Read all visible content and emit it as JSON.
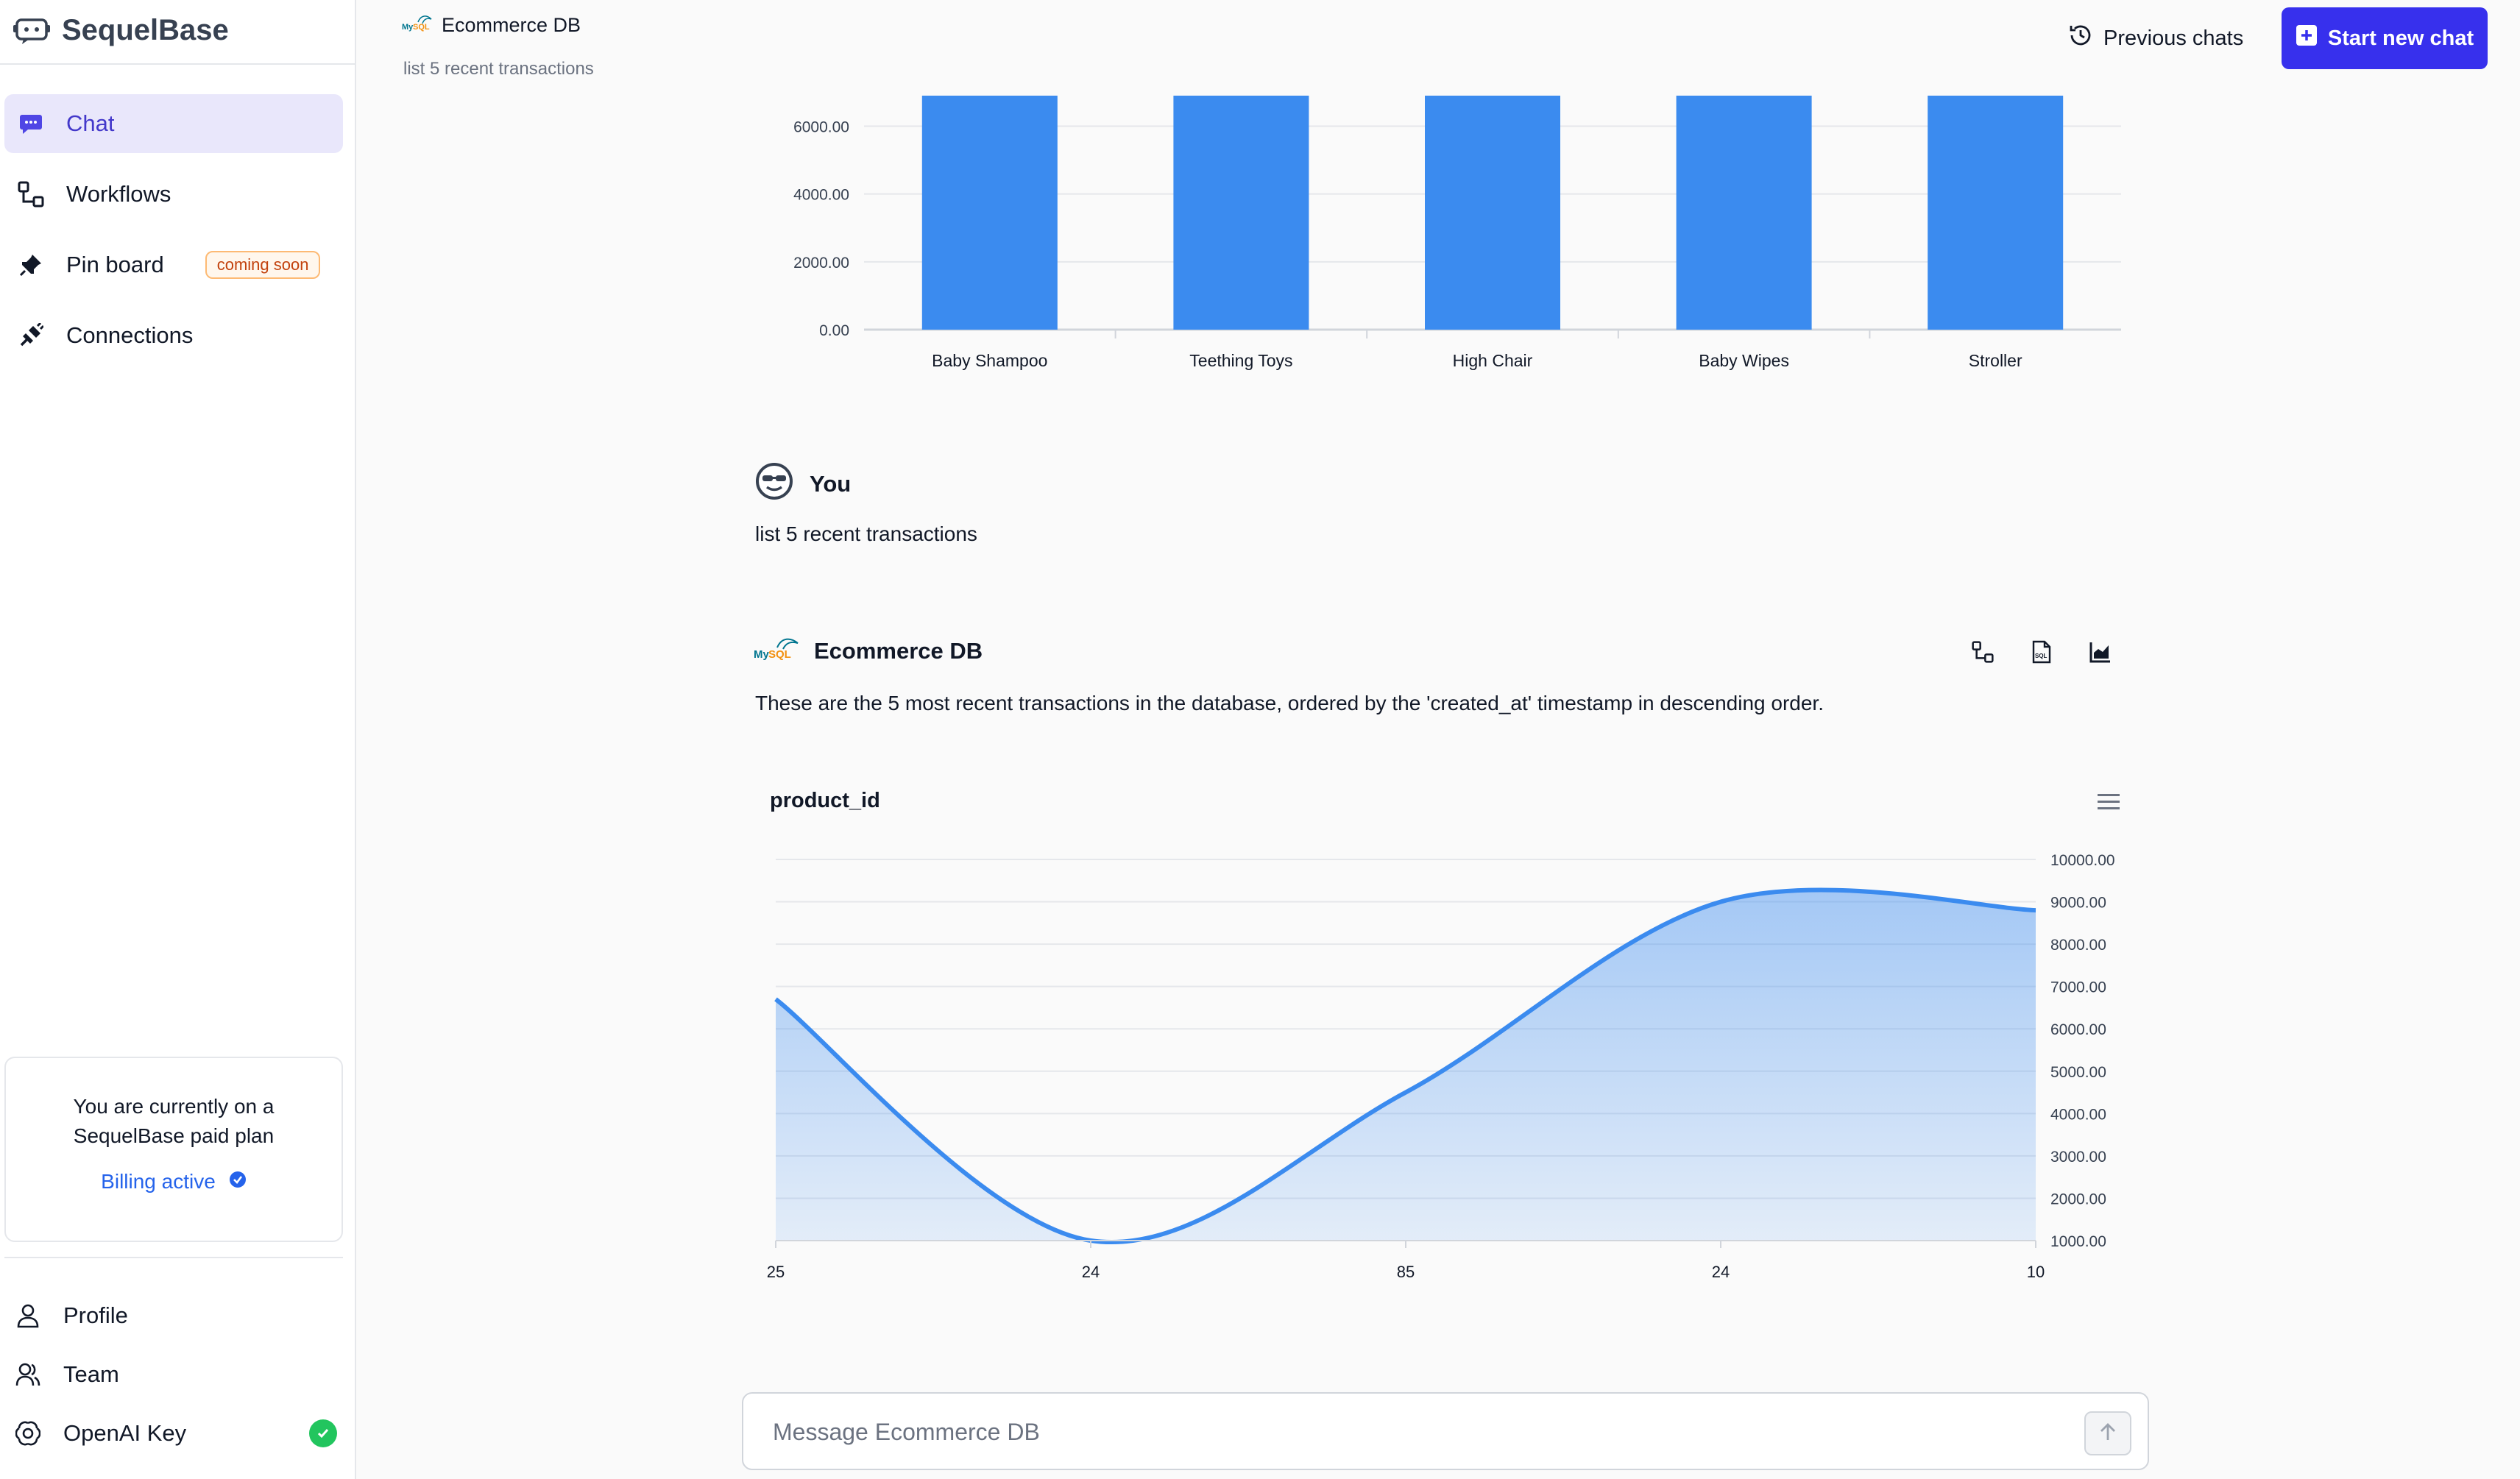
{
  "app": {
    "name": "SequelBase"
  },
  "sidebar": {
    "nav": [
      {
        "label": "Chat",
        "icon": "chat-icon",
        "active": true
      },
      {
        "label": "Workflows",
        "icon": "workflow-icon"
      },
      {
        "label": "Pin board",
        "icon": "pin-icon",
        "badge": "coming soon"
      },
      {
        "label": "Connections",
        "icon": "plug-icon"
      }
    ],
    "plan": {
      "text": "You are currently on a SequelBase paid plan",
      "billing_label": "Billing active"
    },
    "bottom": [
      {
        "label": "Profile",
        "icon": "user-icon"
      },
      {
        "label": "Team",
        "icon": "team-icon"
      },
      {
        "label": "OpenAI Key",
        "icon": "openai-icon",
        "status": "ok"
      }
    ]
  },
  "header": {
    "db_name": "Ecommerce DB",
    "subtitle": "list 5 recent transactions",
    "previous_chats": "Previous chats",
    "new_chat": "Start new chat"
  },
  "messages": {
    "you_label": "You",
    "you_text": "list 5 recent transactions",
    "db_label": "Ecommerce DB",
    "answer": "These are the 5 most recent transactions in the database, ordered by the 'created_at' timestamp in descending order."
  },
  "composer": {
    "placeholder": "Message Ecommerce DB"
  },
  "colors": {
    "accent": "#3730ed",
    "bar": "#3b8bef",
    "area_line": "#3b8bef"
  },
  "chart_data": [
    {
      "type": "bar",
      "categories": [
        "Baby Shampoo",
        "Teething Toys",
        "High Chair",
        "Baby Wipes",
        "Stroller"
      ],
      "values": [
        6900,
        6900,
        6900,
        6900,
        6900
      ],
      "ytick_labels": [
        "0.00",
        "2000.00",
        "4000.00",
        "6000.00"
      ],
      "yticks": [
        0,
        2000,
        4000,
        6000
      ],
      "ylim": [
        0,
        6900
      ],
      "grid": true
    },
    {
      "type": "area",
      "title": "product_id",
      "categories": [
        "25",
        "24",
        "85",
        "24",
        "10"
      ],
      "values": [
        6700,
        1000,
        4500,
        9000,
        8800
      ],
      "ytick_labels": [
        "1000.00",
        "2000.00",
        "3000.00",
        "4000.00",
        "5000.00",
        "6000.00",
        "7000.00",
        "8000.00",
        "9000.00",
        "10000.00"
      ],
      "yticks": [
        1000,
        2000,
        3000,
        4000,
        5000,
        6000,
        7000,
        8000,
        9000,
        10000
      ],
      "ylim": [
        1000,
        10000
      ],
      "grid": true
    }
  ]
}
